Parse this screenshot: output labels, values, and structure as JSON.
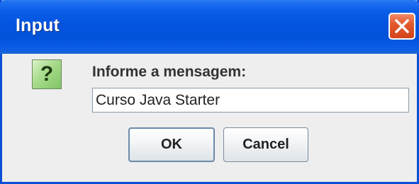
{
  "dialog": {
    "title": "Input",
    "prompt": "Informe a mensagem:",
    "input_value": "Curso Java Starter",
    "buttons": {
      "ok": "OK",
      "cancel": "Cancel"
    },
    "icon": "question-icon",
    "icon_glyph": "?"
  },
  "colors": {
    "titlebar": "#0454e0",
    "close_button": "#e35a2e",
    "dialog_background": "#eeeeee",
    "icon_background": "#a7db8a"
  }
}
